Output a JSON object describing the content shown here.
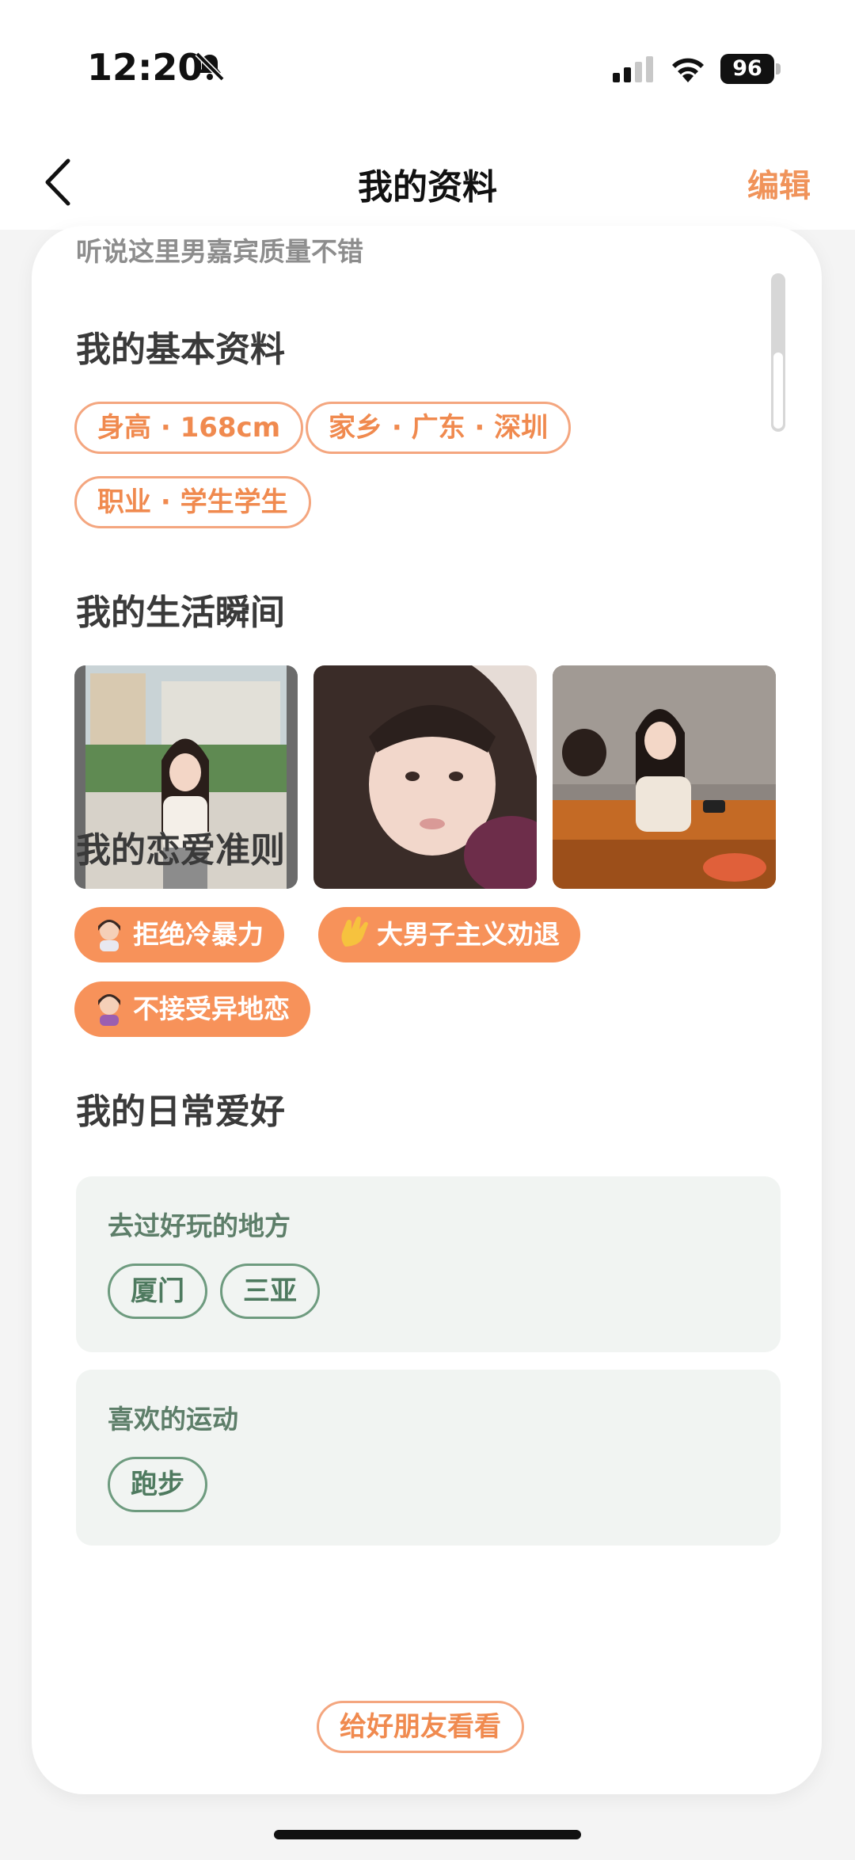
{
  "status_bar": {
    "time": "12:20",
    "battery": "96"
  },
  "nav": {
    "title": "我的资料",
    "edit_label": "编辑"
  },
  "profile": {
    "faded_text": "听说这里男嘉宾质量不错",
    "basic_info": {
      "title": "我的基本资料",
      "tags": [
        "身高 · 168cm",
        "家乡 · 广东 · 深圳",
        "职业 · 学生学生"
      ]
    },
    "life_moments": {
      "title": "我的生活瞬间",
      "photo_count": 3
    },
    "love_rules": {
      "title": "我的恋爱准则",
      "tags": [
        "拒绝冷暴力",
        "大男子主义劝退",
        "不接受异地恋"
      ]
    },
    "hobbies": {
      "title": "我的日常爱好",
      "groups": [
        {
          "title": "去过好玩的地方",
          "tags": [
            "厦门",
            "三亚"
          ]
        },
        {
          "title": "喜欢的运动",
          "tags": [
            "跑步"
          ]
        }
      ]
    },
    "share_label": "给好朋友看看"
  },
  "colors": {
    "accent": "#f7925a",
    "hobby_green": "#5d7e69"
  }
}
